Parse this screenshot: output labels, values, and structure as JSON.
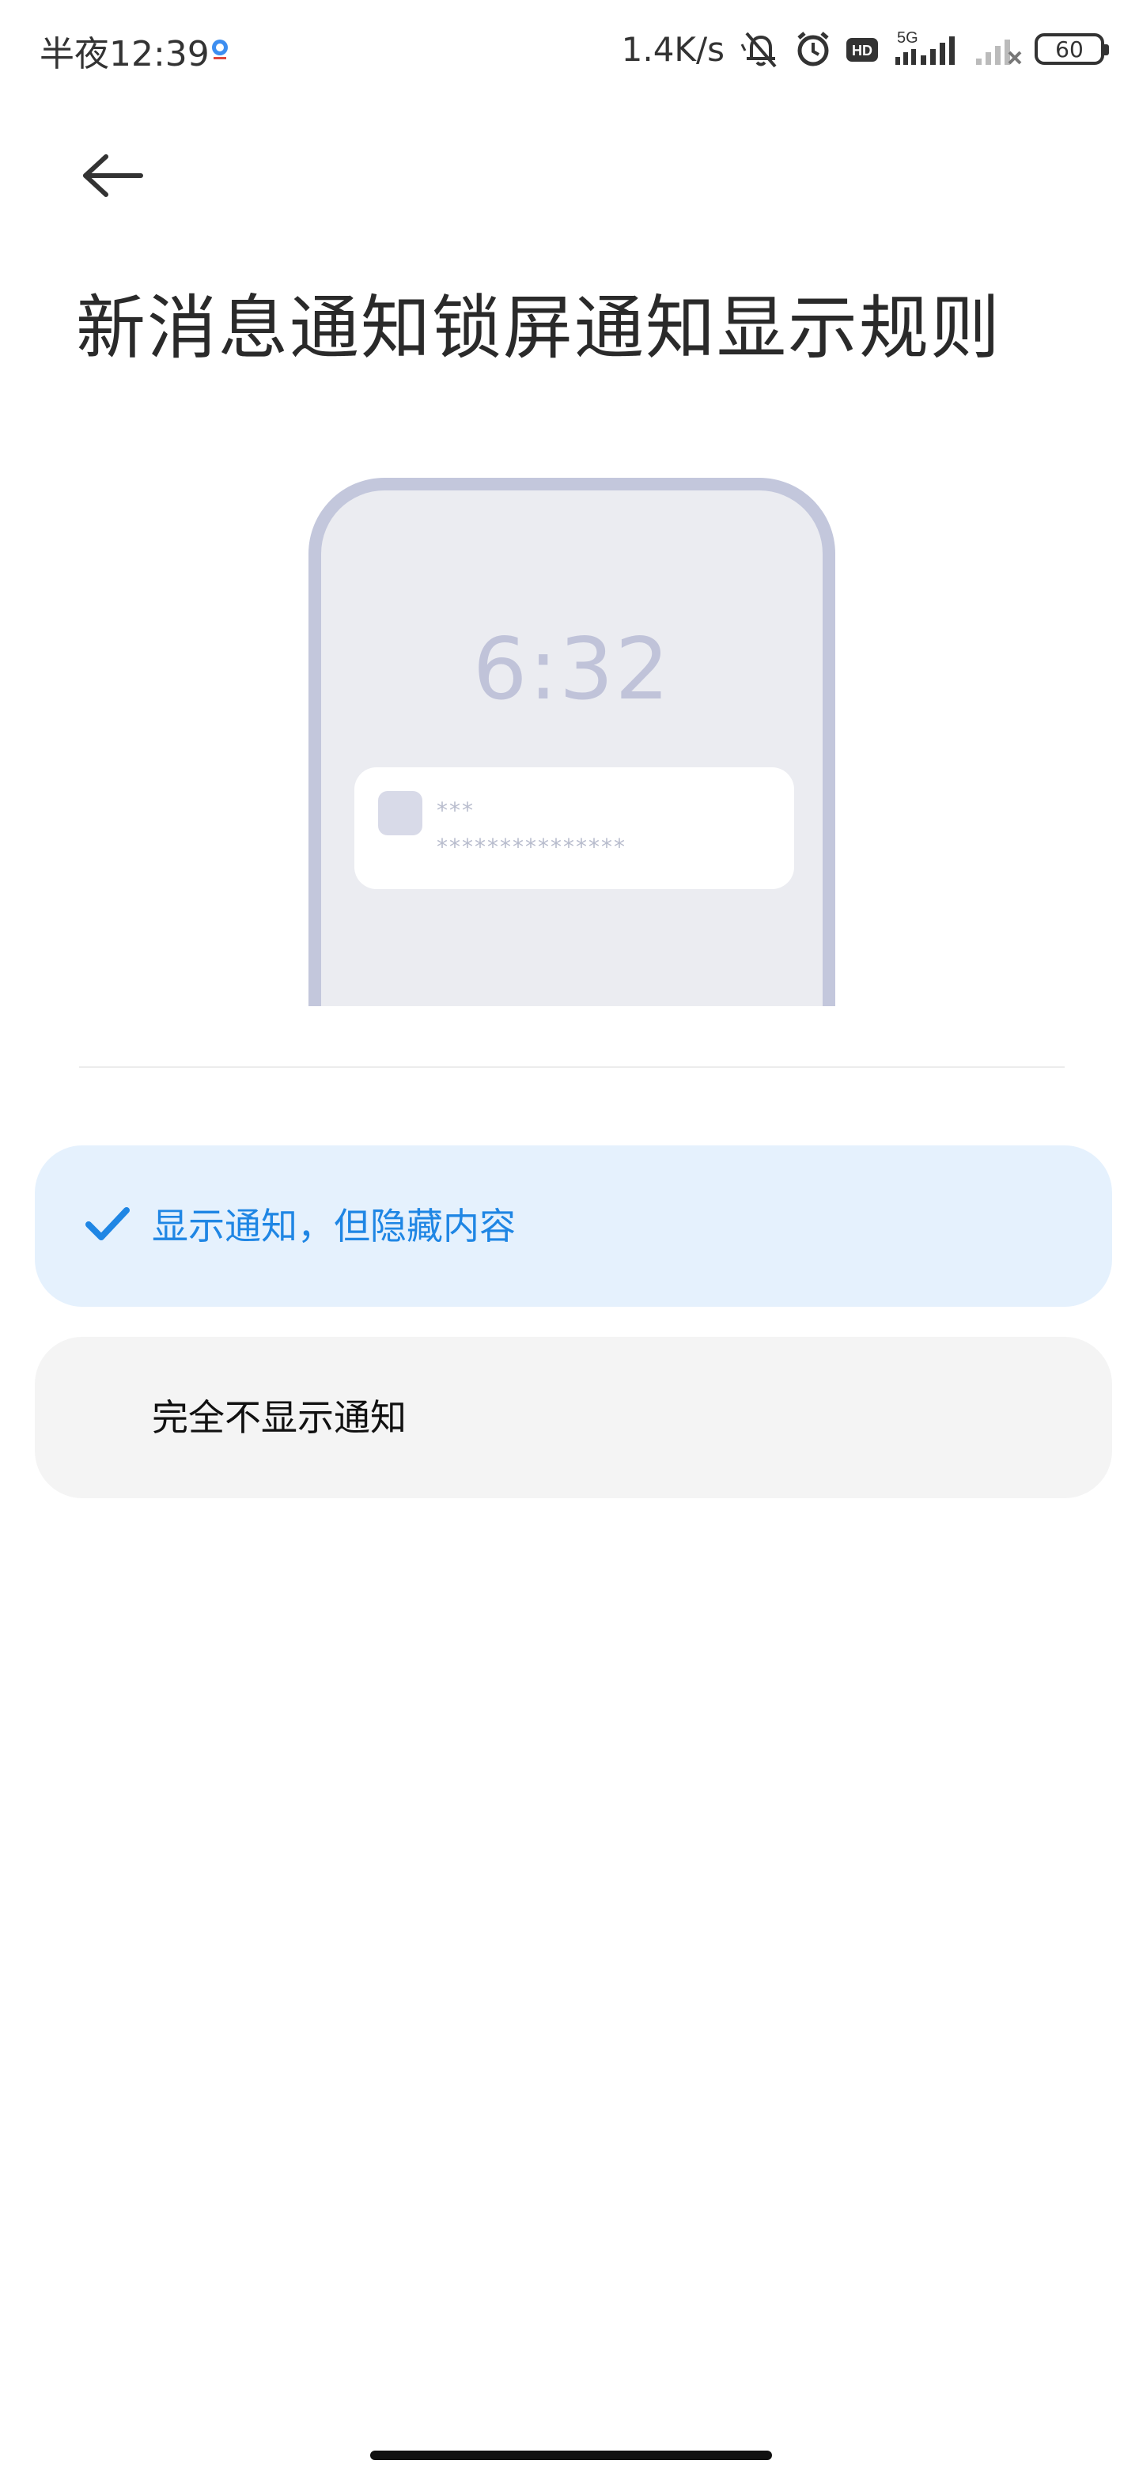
{
  "status_bar": {
    "time": "半夜12:39",
    "network_speed": "1.4K/s",
    "network_type": "5G",
    "hd_badge": "HD",
    "battery": "60"
  },
  "header": {
    "title": "新消息通知锁屏通知显示规则"
  },
  "illustration": {
    "clock": "6:32",
    "notif_line1": "***",
    "notif_line2": "***************"
  },
  "options": [
    {
      "label": "显示通知，但隐藏内容",
      "selected": true
    },
    {
      "label": "完全不显示通知",
      "selected": false
    }
  ],
  "colors": {
    "accent": "#1f86e4",
    "selected_bg": "#e5f1fd",
    "unselected_bg": "#f4f4f4",
    "phone_frame": "#c3c7dc"
  }
}
